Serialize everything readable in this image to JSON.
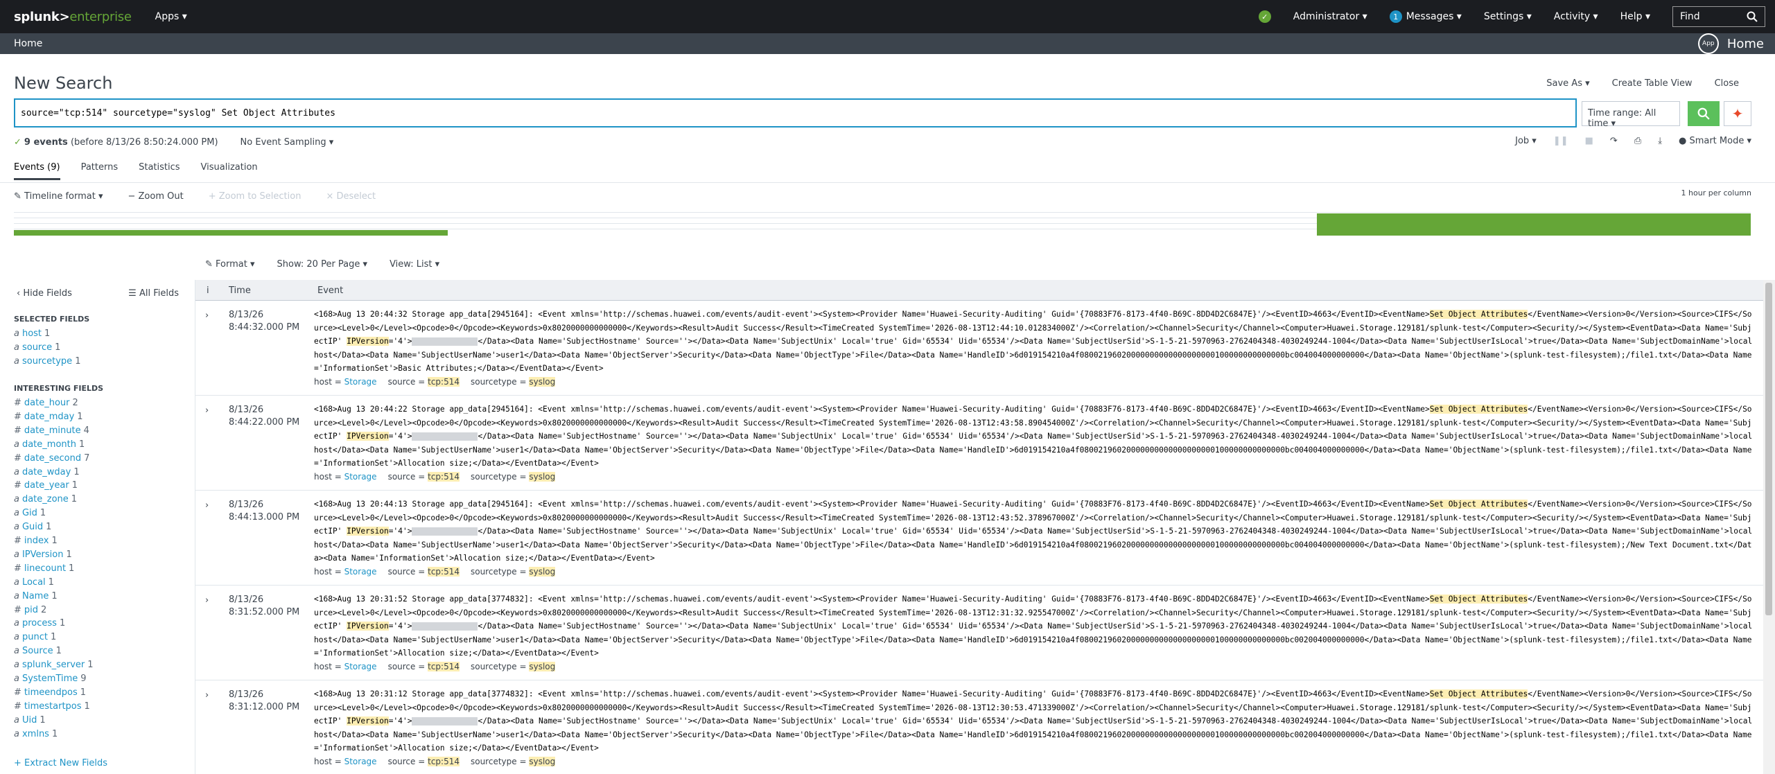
{
  "topbar": {
    "brand_main": "splunk>",
    "brand_sub": "enterprise",
    "apps": "Apps ▾",
    "admin": "Administrator ▾",
    "messages_count": "1",
    "messages": "Messages ▾",
    "settings": "Settings ▾",
    "activity": "Activity ▾",
    "help": "Help ▾",
    "find": "Find"
  },
  "appbar": {
    "home": "Home",
    "app_icon": "App",
    "app_home": "Home"
  },
  "search": {
    "title": "New Search",
    "save_as": "Save As ▾",
    "create_table": "Create Table View",
    "close": "Close",
    "query": "source=\"tcp:514\" sourcetype=\"syslog\" Set Object Attributes",
    "time_range": "Time range: All time ▾"
  },
  "status": {
    "events_count": "9 events",
    "events_range": "(before 8/13/26 8:50:24.000 PM)",
    "sampling": "No Event Sampling ▾",
    "job": "Job ▾",
    "smart_mode": "Smart Mode ▾"
  },
  "tabs": [
    "Events (9)",
    "Patterns",
    "Statistics",
    "Visualization"
  ],
  "timeline": {
    "format": "Timeline format ▾",
    "zoom_out": "− Zoom Out",
    "zoom_sel": "+ Zoom to Selection",
    "deselect": "× Deselect",
    "scale": "1 hour per column"
  },
  "results_bar": {
    "format": "Format ▾",
    "per_page": "Show: 20 Per Page ▾",
    "view": "View: List ▾"
  },
  "sidebar": {
    "hide": "‹ Hide Fields",
    "all": "☰ All Fields",
    "selected_header": "SELECTED FIELDS",
    "selected": [
      {
        "name": "host",
        "count": "1"
      },
      {
        "name": "source",
        "count": "1"
      },
      {
        "name": "sourcetype",
        "count": "1"
      }
    ],
    "interesting_header": "INTERESTING FIELDS",
    "interesting": [
      {
        "t": "#",
        "name": "date_hour",
        "count": "2"
      },
      {
        "t": "#",
        "name": "date_mday",
        "count": "1"
      },
      {
        "t": "#",
        "name": "date_minute",
        "count": "4"
      },
      {
        "t": "a",
        "name": "date_month",
        "count": "1"
      },
      {
        "t": "#",
        "name": "date_second",
        "count": "7"
      },
      {
        "t": "a",
        "name": "date_wday",
        "count": "1"
      },
      {
        "t": "#",
        "name": "date_year",
        "count": "1"
      },
      {
        "t": "a",
        "name": "date_zone",
        "count": "1"
      },
      {
        "t": "a",
        "name": "Gid",
        "count": "1"
      },
      {
        "t": "a",
        "name": "Guid",
        "count": "1"
      },
      {
        "t": "#",
        "name": "index",
        "count": "1"
      },
      {
        "t": "a",
        "name": "IPVersion",
        "count": "1"
      },
      {
        "t": "#",
        "name": "linecount",
        "count": "1"
      },
      {
        "t": "a",
        "name": "Local",
        "count": "1"
      },
      {
        "t": "a",
        "name": "Name",
        "count": "1"
      },
      {
        "t": "#",
        "name": "pid",
        "count": "2"
      },
      {
        "t": "a",
        "name": "process",
        "count": "1"
      },
      {
        "t": "a",
        "name": "punct",
        "count": "1"
      },
      {
        "t": "a",
        "name": "Source",
        "count": "1"
      },
      {
        "t": "a",
        "name": "splunk_server",
        "count": "1"
      },
      {
        "t": "a",
        "name": "SystemTime",
        "count": "9"
      },
      {
        "t": "#",
        "name": "timeendpos",
        "count": "1"
      },
      {
        "t": "#",
        "name": "timestartpos",
        "count": "1"
      },
      {
        "t": "a",
        "name": "Uid",
        "count": "1"
      },
      {
        "t": "a",
        "name": "xmlns",
        "count": "1"
      }
    ],
    "extract": "+ Extract New Fields"
  },
  "events_header": {
    "info": "i",
    "time": "Time",
    "event": "Event"
  },
  "events": [
    {
      "date": "8/13/26",
      "time": "8:44:32.000 PM",
      "syslog": "Aug 13 20:44:32 Storage app_data[2945164]",
      "created": "2026-08-13T12:44:10.012834000Z",
      "path": "/file1.txt",
      "infoset": "Basic Attributes;",
      "handle": "6d019154210a4f08002196020000000000000000000100000000000000bc004004000000000"
    },
    {
      "date": "8/13/26",
      "time": "8:44:22.000 PM",
      "syslog": "Aug 13 20:44:22 Storage app_data[2945164]",
      "created": "2026-08-13T12:43:58.890454000Z",
      "path": "/file1.txt",
      "infoset": "Allocation size;",
      "handle": "6d019154210a4f08002196020000000000000000000100000000000000bc004004000000000"
    },
    {
      "date": "8/13/26",
      "time": "8:44:13.000 PM",
      "syslog": "Aug 13 20:44:13 Storage app_data[2945164]",
      "created": "2026-08-13T12:43:52.378967000Z",
      "path": "/New Text Document.txt",
      "infoset": "Allocation size;",
      "handle": "6d019154210a4f08002196020000000000000000000100000000000000bc004004000000000"
    },
    {
      "date": "8/13/26",
      "time": "8:31:52.000 PM",
      "syslog": "Aug 13 20:31:52 Storage app_data[3774832]",
      "created": "2026-08-13T12:31:32.925547000Z",
      "path": "/file1.txt",
      "infoset": "Allocation size;",
      "handle": "6d019154210a4f08002196020000000000000000000100000000000000bc002004000000000"
    },
    {
      "date": "8/13/26",
      "time": "8:31:12.000 PM",
      "syslog": "Aug 13 20:31:12 Storage app_data[3774832]",
      "created": "2026-08-13T12:30:53.471339000Z",
      "path": "/file1.txt",
      "infoset": "Allocation size;",
      "handle": "6d019154210a4f08002196020000000000000000000100000000000000bc002004000000000"
    }
  ],
  "event_common": {
    "prefix": "<168>",
    "xmlns": "http://schemas.huawei.com/events/audit-event",
    "provider": "Huawei-Security-Auditing",
    "guid": "{70883F76-8173-4f40-B69C-8DD4D2C6847E}",
    "event_id": "4663",
    "event_name": "Set Object Attributes",
    "source": "CIFS",
    "level": "0",
    "opcode": "0",
    "keywords": "0x8020000000000000",
    "result": "Audit Success",
    "channel": "Security",
    "computer": "Huawei.Storage.129181/splunk-test",
    "subject_hostname": "",
    "subject_unix_local": "true",
    "gid": "65534",
    "uid": "65534",
    "subject_sid": "S-1-5-21-5970963-2762404348-4030249244-1004",
    "subject_is_local": "true",
    "domain": "localhost",
    "user": "user1",
    "object_server": "Security",
    "object_type": "File",
    "object_prefix": "(splunk-test-filesystem);",
    "host_label": "host =",
    "host_val": "Storage",
    "source_label": "source =",
    "source_val": "tcp:514",
    "sourcetype_label": "sourcetype =",
    "sourcetype_val": "syslog"
  },
  "colors": {
    "topbar": "#1b1d21",
    "appbar": "#3c444d",
    "accent_green": "#65a637",
    "link_blue": "#1e93c6",
    "highlight": "#fdeeb3",
    "search_border": "#1e93c6"
  }
}
